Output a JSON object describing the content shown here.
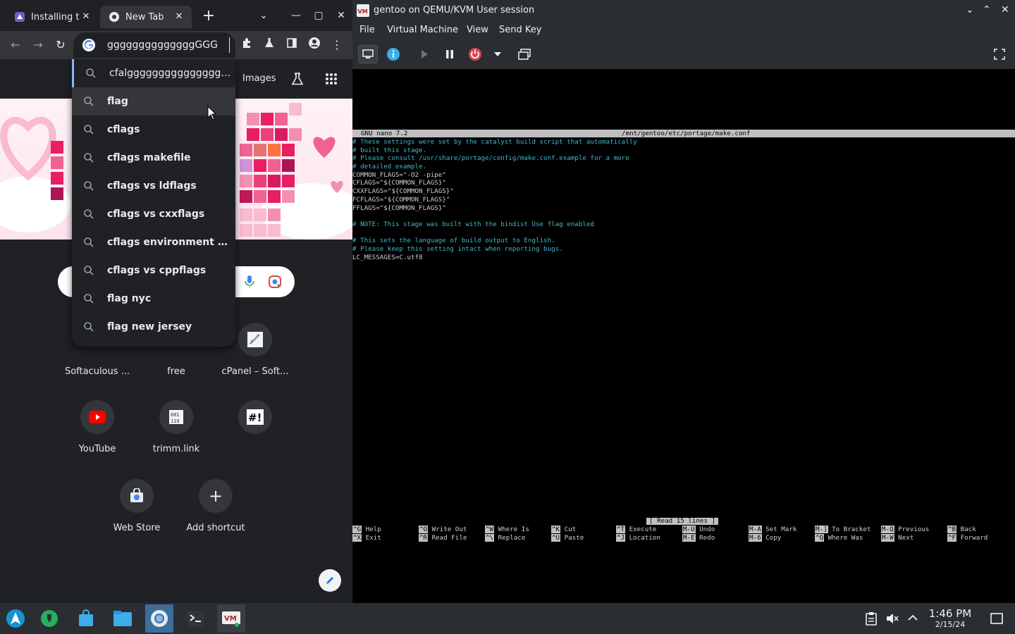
{
  "chrome": {
    "tabs": [
      {
        "label": "Installing t"
      },
      {
        "label": "New Tab"
      }
    ],
    "omnibox_value": "ggggggggggggggGGG",
    "suggestions": [
      "cfalggggggggggggggggg...",
      "flag",
      "cflags",
      "cflags makefile",
      "cflags vs ldflags",
      "cflags vs cxxflags",
      "cflags environment var...",
      "cflags vs cppflags",
      "flag nyc",
      "flag new jersey"
    ],
    "ntp": {
      "images_link": "Images",
      "shortcuts": [
        {
          "label": "Softaculous ...",
          "icon": "softaculous-icon"
        },
        {
          "label": "free",
          "icon": "free-icon"
        },
        {
          "label": "cPanel – Soft...",
          "icon": "cpanel-icon"
        },
        {
          "label": "YouTube",
          "icon": "youtube-icon"
        },
        {
          "label": "trimm.link",
          "icon": "trimm-icon"
        },
        {
          "label": "",
          "icon": "hashtag-icon"
        },
        {
          "label": "Web Store",
          "icon": "webstore-icon"
        },
        {
          "label": "Add shortcut",
          "icon": "plus-icon"
        }
      ]
    }
  },
  "vm": {
    "title": "gentoo on QEMU/KVM User session",
    "menu": [
      "File",
      "Virtual Machine",
      "View",
      "Send Key"
    ],
    "nano": {
      "version": "GNU nano 7.2",
      "filename": "/mnt/gentoo/etc/portage/make.conf",
      "lines": [
        {
          "text": "# These settings were set by the catalyst build script that automatically",
          "comment": true
        },
        {
          "text": "# built this stage.",
          "comment": true
        },
        {
          "text": "# Please consult /usr/share/portage/config/make.conf.example for a more",
          "comment": true
        },
        {
          "text": "# detailed example.",
          "comment": true
        },
        {
          "text": "COMMON_FLAGS=\"-O2 -pipe\"",
          "comment": false
        },
        {
          "text": "CFLAGS=\"${COMMON_FLAGS}\"",
          "comment": false
        },
        {
          "text": "CXXFLAGS=\"${COMMON_FLAGS}\"",
          "comment": false
        },
        {
          "text": "FCFLAGS=\"${COMMON_FLAGS}\"",
          "comment": false
        },
        {
          "text": "FFLAGS=\"${COMMON_FLAGS}\"",
          "comment": false
        },
        {
          "text": "",
          "comment": false
        },
        {
          "text": "# NOTE: This stage was built with the bindist Use flag enabled",
          "comment": true
        },
        {
          "text": "",
          "comment": false
        },
        {
          "text": "# This sets the language of build output to English.",
          "comment": true
        },
        {
          "text": "# Please keep this setting intact when reporting bugs.",
          "comment": true
        },
        {
          "text": "LC_MESSAGES=C.utf8",
          "comment": false
        }
      ],
      "status": "[ Read 15 lines ]",
      "shortcuts_row1": [
        {
          "k": "^G",
          "l": "Help"
        },
        {
          "k": "^O",
          "l": "Write Out"
        },
        {
          "k": "^W",
          "l": "Where Is"
        },
        {
          "k": "^K",
          "l": "Cut"
        },
        {
          "k": "^T",
          "l": "Execute"
        },
        {
          "k": "M-U",
          "l": "Undo"
        },
        {
          "k": "M-A",
          "l": "Set Mark"
        },
        {
          "k": "M-]",
          "l": "To Bracket"
        },
        {
          "k": "M-Q",
          "l": "Previous"
        },
        {
          "k": "^B",
          "l": "Back"
        }
      ],
      "shortcuts_row2": [
        {
          "k": "^X",
          "l": "Exit"
        },
        {
          "k": "^R",
          "l": "Read File"
        },
        {
          "k": "^\\",
          "l": "Replace"
        },
        {
          "k": "^U",
          "l": "Paste"
        },
        {
          "k": "^J",
          "l": "Location"
        },
        {
          "k": "M-E",
          "l": "Redo"
        },
        {
          "k": "M-6",
          "l": "Copy"
        },
        {
          "k": "^Q",
          "l": "Where Was"
        },
        {
          "k": "M-W",
          "l": "Next"
        },
        {
          "k": "^F",
          "l": "Forward"
        }
      ]
    }
  },
  "taskbar": {
    "time": "1:46 PM",
    "date": "2/15/24"
  }
}
